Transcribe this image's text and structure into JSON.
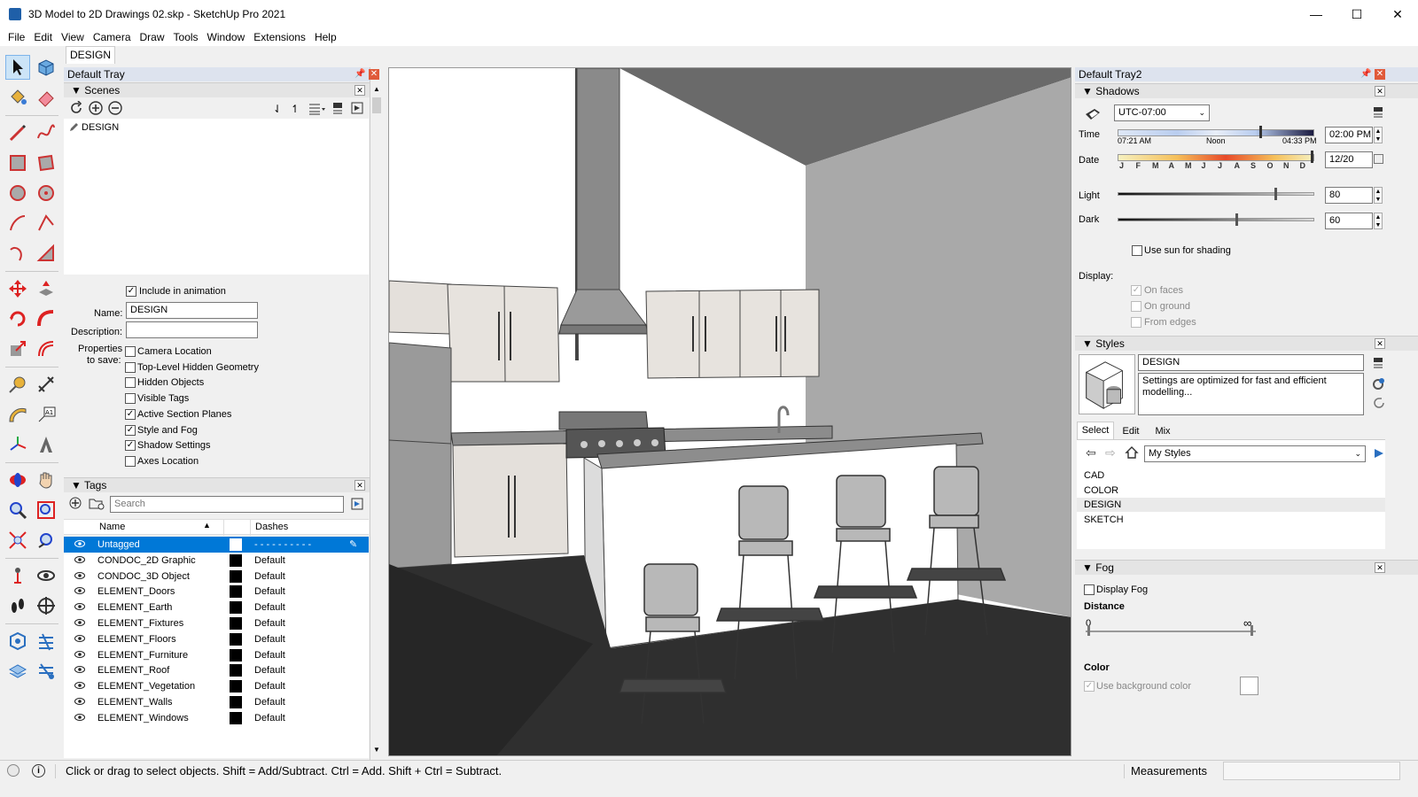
{
  "window": {
    "title": "3D Model to 2D Drawings 02.skp - SketchUp Pro 2021",
    "minimize": "—",
    "maximize": "☐",
    "close": "✕"
  },
  "menu": [
    "File",
    "Edit",
    "View",
    "Camera",
    "Draw",
    "Tools",
    "Window",
    "Extensions",
    "Help"
  ],
  "scene_tab": "DESIGN",
  "left_tray": {
    "title": "Default Tray",
    "scenes": {
      "header": "Scenes",
      "items": [
        "DESIGN"
      ],
      "include_in_animation": "Include in animation",
      "name_label": "Name:",
      "name_value": "DESIGN",
      "description_label": "Description:",
      "description_value": "",
      "properties_label_1": "Properties",
      "properties_label_2": "to save:",
      "properties": [
        {
          "label": "Camera Location",
          "checked": false
        },
        {
          "label": "Top-Level Hidden Geometry",
          "checked": false
        },
        {
          "label": "Hidden Objects",
          "checked": false
        },
        {
          "label": "Visible Tags",
          "checked": false
        },
        {
          "label": "Active Section Planes",
          "checked": true
        },
        {
          "label": "Style and Fog",
          "checked": true
        },
        {
          "label": "Shadow Settings",
          "checked": true
        },
        {
          "label": "Axes Location",
          "checked": false
        }
      ]
    },
    "tags": {
      "header": "Tags",
      "search_placeholder": "Search",
      "col_name": "Name",
      "col_dashes": "Dashes",
      "rows": [
        {
          "name": "Untagged",
          "dashes": "- - - - - - - - - -",
          "selected": true
        },
        {
          "name": "CONDOC_2D Graphic",
          "dashes": "Default"
        },
        {
          "name": "CONDOC_3D Object",
          "dashes": "Default"
        },
        {
          "name": "ELEMENT_Doors",
          "dashes": "Default"
        },
        {
          "name": "ELEMENT_Earth",
          "dashes": "Default"
        },
        {
          "name": "ELEMENT_Fixtures",
          "dashes": "Default"
        },
        {
          "name": "ELEMENT_Floors",
          "dashes": "Default"
        },
        {
          "name": "ELEMENT_Furniture",
          "dashes": "Default"
        },
        {
          "name": "ELEMENT_Roof",
          "dashes": "Default"
        },
        {
          "name": "ELEMENT_Vegetation",
          "dashes": "Default"
        },
        {
          "name": "ELEMENT_Walls",
          "dashes": "Default"
        },
        {
          "name": "ELEMENT_Windows",
          "dashes": "Default"
        }
      ]
    }
  },
  "right_tray": {
    "title": "Default Tray2",
    "shadows": {
      "header": "Shadows",
      "timezone": "UTC-07:00",
      "time_label": "Time",
      "time_start": "07:21 AM",
      "time_mid": "Noon",
      "time_end": "04:33 PM",
      "time_value": "02:00 PM",
      "date_label": "Date",
      "months": [
        "J",
        "F",
        "M",
        "A",
        "M",
        "J",
        "J",
        "A",
        "S",
        "O",
        "N",
        "D"
      ],
      "date_value": "12/20",
      "light_label": "Light",
      "light_value": "80",
      "dark_label": "Dark",
      "dark_value": "60",
      "use_sun": "Use sun for shading",
      "display_label": "Display:",
      "on_faces": "On faces",
      "on_ground": "On ground",
      "from_edges": "From edges"
    },
    "styles": {
      "header": "Styles",
      "name": "DESIGN",
      "description": "Settings are optimized for fast and efficient modelling...",
      "tabs": [
        "Select",
        "Edit",
        "Mix"
      ],
      "collection": "My Styles",
      "list": [
        "CAD",
        "COLOR",
        "DESIGN",
        "SKETCH"
      ]
    },
    "fog": {
      "header": "Fog",
      "display_fog": "Display Fog",
      "distance_label": "Distance",
      "dist_start": "0",
      "dist_end": "∞",
      "color_label": "Color",
      "use_bg": "Use background color"
    }
  },
  "status": {
    "message": "Click or drag to select objects. Shift = Add/Subtract. Ctrl = Add. Shift + Ctrl = Subtract.",
    "measurements_label": "Measurements",
    "measurements_value": ""
  },
  "colors": {
    "selection": "#0078d7",
    "tray_header": "#dde3ee",
    "close_red": "#e05a3a"
  }
}
